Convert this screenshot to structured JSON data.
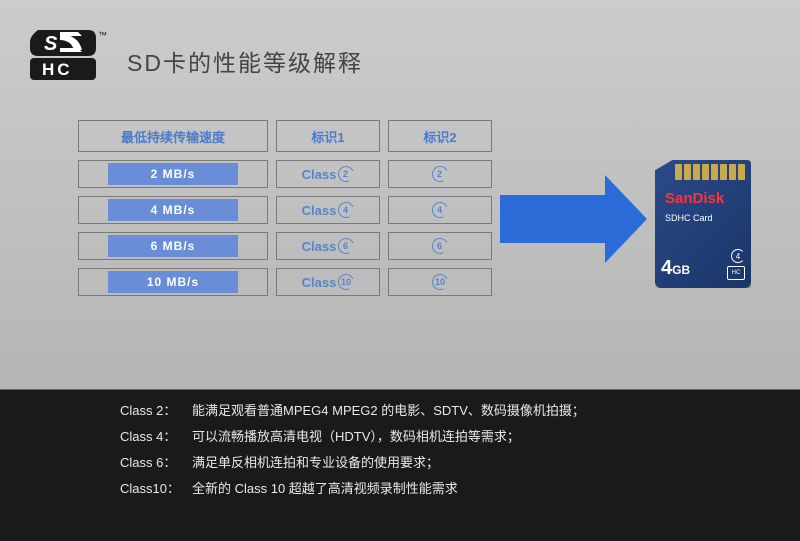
{
  "title": "SD卡的性能等级解释",
  "logo": {
    "top": "SD",
    "bottom": "HC",
    "tm": "™"
  },
  "table": {
    "headers": {
      "speed": "最低持续传输速度",
      "badge1": "标识1",
      "badge2": "标识2"
    },
    "rows": [
      {
        "speed": "2 MB/s",
        "class_label": "Class",
        "num": "2"
      },
      {
        "speed": "4 MB/s",
        "class_label": "Class",
        "num": "4"
      },
      {
        "speed": "6 MB/s",
        "class_label": "Class",
        "num": "6"
      },
      {
        "speed": "10 MB/s",
        "class_label": "Class",
        "num": "10"
      }
    ]
  },
  "sdcard": {
    "brand": "SanDisk",
    "type": "SDHC Card",
    "class_num": "4",
    "logo": "SD HC",
    "capacity_num": "4",
    "capacity_unit": "GB"
  },
  "footer": [
    {
      "label": "Class 2：",
      "desc": "能满足观看普通MPEG4 MPEG2 的电影、SDTV、数码摄像机拍摄；"
    },
    {
      "label": "Class 4：",
      "desc": "可以流畅播放高清电视（HDTV），数码相机连拍等需求；"
    },
    {
      "label": "Class 6：",
      "desc": "满足单反相机连拍和专业设备的使用要求；"
    },
    {
      "label": "Class10：",
      "desc": "全新的 Class 10 超越了高清视频录制性能需求"
    }
  ]
}
